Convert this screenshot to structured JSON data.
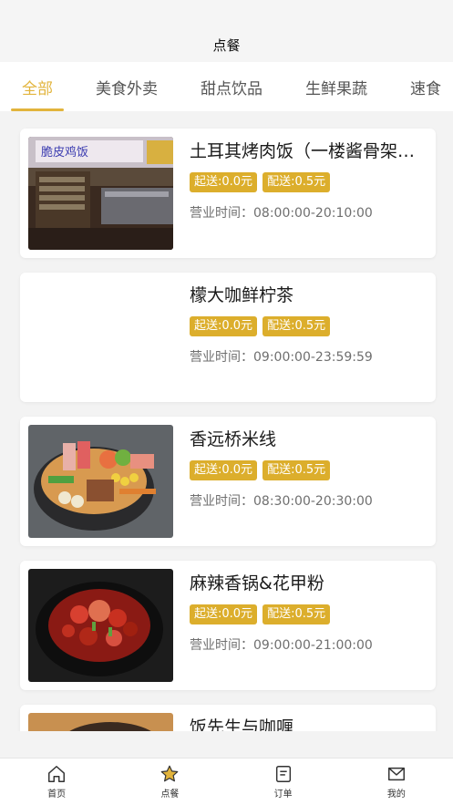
{
  "header": {
    "title": "点餐"
  },
  "tabs": [
    {
      "label": "全部",
      "active": true
    },
    {
      "label": "美食外卖"
    },
    {
      "label": "甜点饮品"
    },
    {
      "label": "生鲜果蔬"
    },
    {
      "label": "速食"
    }
  ],
  "stores": [
    {
      "name": "土耳其烤肉饭（一楼酱骨架旁）",
      "min_order": "起送:0.0元",
      "delivery_fee": "配送:0.5元",
      "hours": "营业时间：08:00:00-20:10:00",
      "image": "storefront-photo"
    },
    {
      "name": "檬大咖鲜柠茶",
      "min_order": "起送:0.0元",
      "delivery_fee": "配送:0.5元",
      "hours": "营业时间：09:00:00-23:59:59",
      "image": ""
    },
    {
      "name": "香远桥米线",
      "min_order": "起送:0.0元",
      "delivery_fee": "配送:0.5元",
      "hours": "营业时间：08:30:00-20:30:00",
      "image": "rice-noodle-bowl-photo"
    },
    {
      "name": "麻辣香锅&花甲粉",
      "min_order": "起送:0.0元",
      "delivery_fee": "配送:0.5元",
      "hours": "营业时间：09:00:00-21:00:00",
      "image": "spicy-pot-photo"
    },
    {
      "name": "饭先生与咖喱",
      "image": "clay-pot-photo"
    }
  ],
  "storefront_sign": "脆皮鸡饭",
  "tabbar": [
    {
      "label": "首页",
      "icon": "home-icon"
    },
    {
      "label": "点餐",
      "icon": "star-icon",
      "active": true
    },
    {
      "label": "订单",
      "icon": "order-icon"
    },
    {
      "label": "我的",
      "icon": "profile-icon"
    }
  ],
  "colors": {
    "accent": "#e2b43c",
    "tag_bg": "#dcae2c"
  }
}
